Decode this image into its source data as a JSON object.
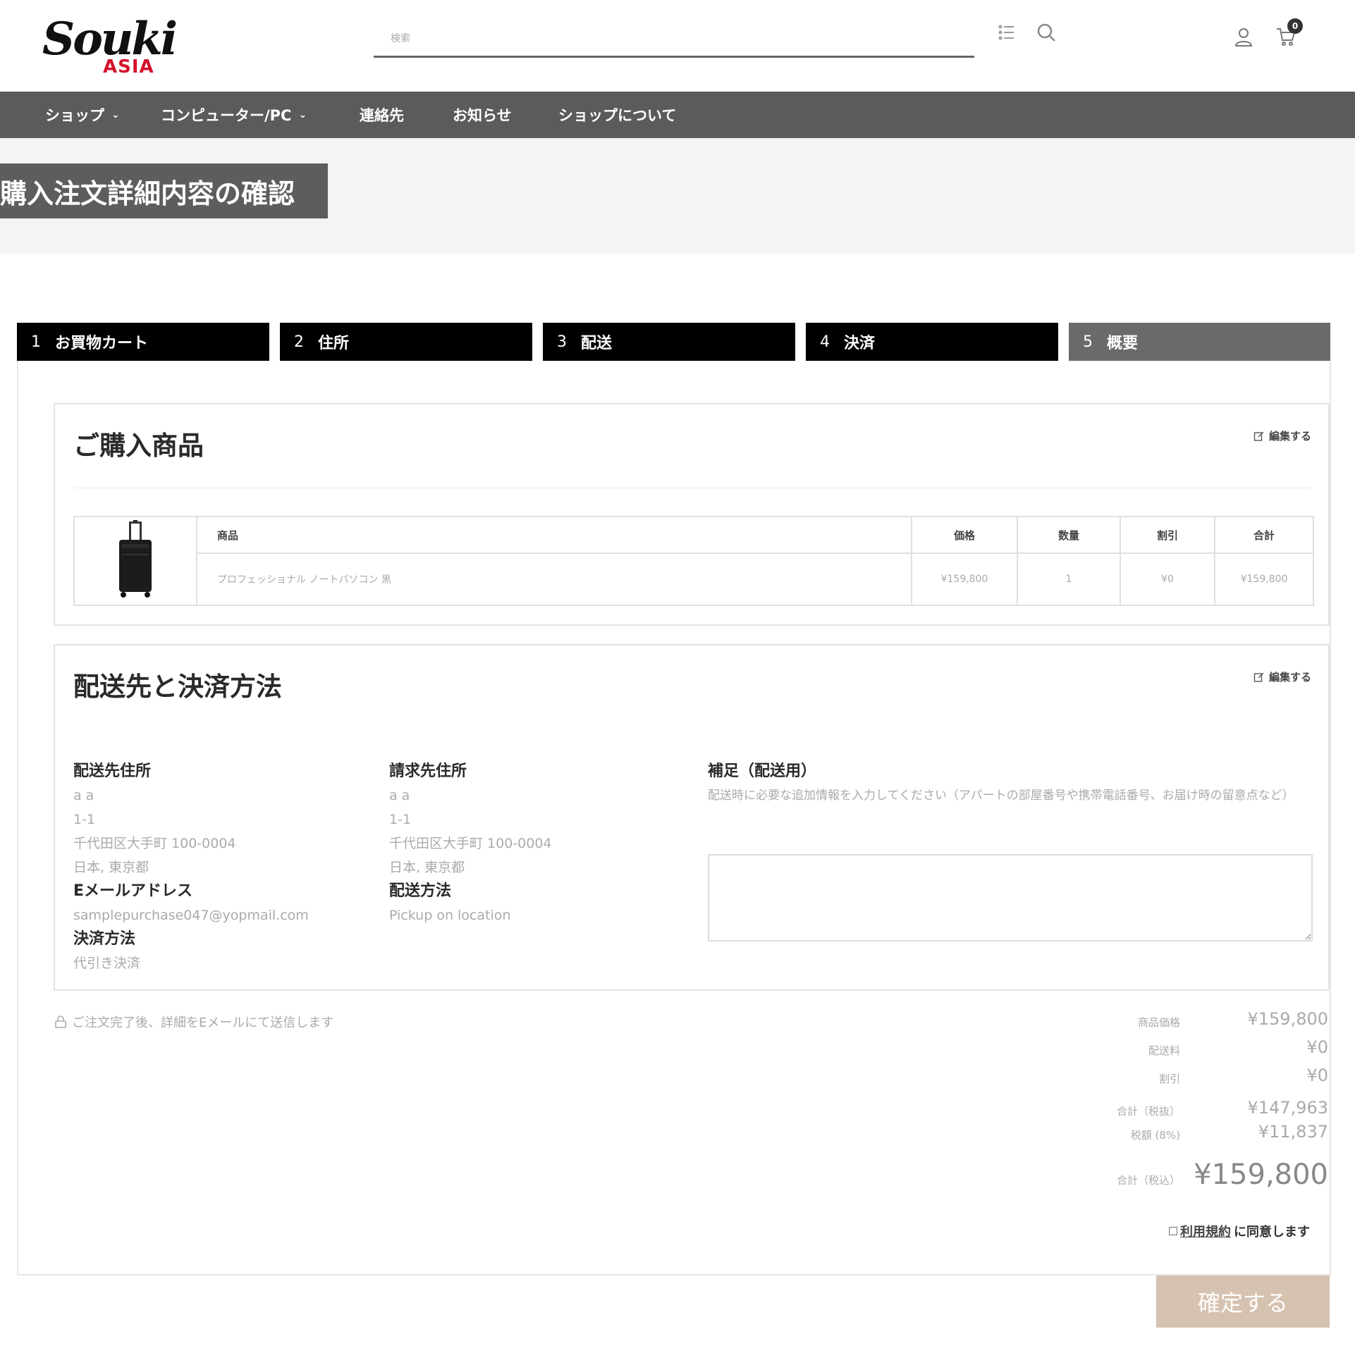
{
  "brand": {
    "name": "Souki",
    "sub": "ASIA",
    "accent": "#d4122c"
  },
  "search": {
    "placeholder": "検索"
  },
  "header": {
    "cart_count": "0"
  },
  "nav": {
    "items": [
      {
        "label": "ショップ",
        "has_dropdown": true
      },
      {
        "label": "コンピューター/PC",
        "has_dropdown": true
      },
      {
        "label": "連絡先",
        "has_dropdown": false
      },
      {
        "label": "お知らせ",
        "has_dropdown": false
      },
      {
        "label": "ショップについて",
        "has_dropdown": false
      }
    ]
  },
  "page": {
    "title": "購入注文詳細内容の確認"
  },
  "steps": [
    {
      "num": "1",
      "label": "お買物カート"
    },
    {
      "num": "2",
      "label": "住所"
    },
    {
      "num": "3",
      "label": "配送"
    },
    {
      "num": "4",
      "label": "決済"
    },
    {
      "num": "5",
      "label": "概要"
    }
  ],
  "products": {
    "title": "ご購入商品",
    "edit": "編集する",
    "headers": {
      "product": "商品",
      "price": "価格",
      "qty": "数量",
      "discount": "割引",
      "total": "合計"
    },
    "rows": [
      {
        "name": "プロフェッショナル ノートパソコン 黒",
        "price": "¥159,800",
        "qty": "1",
        "discount": "¥0",
        "total": "¥159,800"
      }
    ]
  },
  "shipping": {
    "title": "配送先と決済方法",
    "edit": "編集する",
    "ship_addr": {
      "label": "配送先住所",
      "name": "a a",
      "line1": "1-1",
      "line2": "千代田区大手町 100-0004",
      "line3": "日本, 東京都"
    },
    "bill_addr": {
      "label": "請求先住所",
      "name": "a a",
      "line1": "1-1",
      "line2": "千代田区大手町 100-0004",
      "line3": "日本, 東京都"
    },
    "email": {
      "label": "Eメールアドレス",
      "value": "samplepurchase047@yopmail.com"
    },
    "payment": {
      "label": "決済方法",
      "value": "代引き決済"
    },
    "delivery": {
      "label": "配送方法",
      "value": "Pickup on location"
    },
    "note": {
      "label": "補足（配送用）",
      "help": "配送時に必要な追加情報を入力してください（アパートの部屋番号や携帯電話番号、お届け時の留意点など）",
      "value": ""
    }
  },
  "summary": {
    "notice": "ご注文完了後、詳細をEメールにて送信します",
    "rows": [
      {
        "label": "商品価格",
        "value": "¥159,800"
      },
      {
        "label": "配送料",
        "value": "¥0"
      },
      {
        "label": "割引",
        "value": "¥0"
      },
      {
        "label": "合計（税抜）",
        "value": "¥147,963"
      },
      {
        "label": "税額 (8%)",
        "value": "¥11,837"
      }
    ],
    "total": {
      "label": "合計（税込）",
      "value": "¥159,800"
    },
    "terms_link": "利用規約",
    "terms_text": "に同意します",
    "confirm": "確定する",
    "confirm_color": "#d6c2b0"
  }
}
